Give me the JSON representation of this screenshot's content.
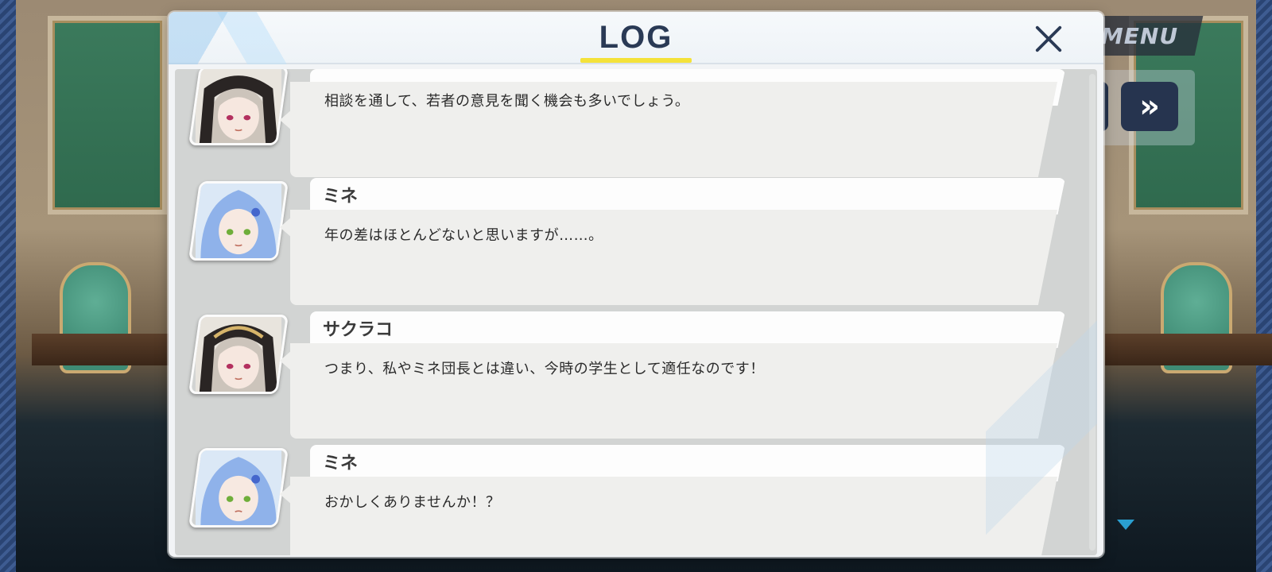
{
  "hud": {
    "menu_label": "MENU",
    "fast_forward_label": "»"
  },
  "log": {
    "title": "LOG",
    "close_label": "close",
    "entries": [
      {
        "speaker": "",
        "text": "相談を通して、若者の意見を聞く機会も多いでしょう。",
        "avatar": "sakurako"
      },
      {
        "speaker": "ミネ",
        "text": "年の差はほとんどないと思いますが……。",
        "avatar": "mine"
      },
      {
        "speaker": "サクラコ",
        "text": "つまり、私やミネ団長とは違い、今時の学生として適任なのです！",
        "avatar": "sakurako"
      },
      {
        "speaker": "ミネ",
        "text": "おかしくありませんか！？",
        "avatar": "mine"
      }
    ]
  },
  "colors": {
    "title_underline": "#f4e23a",
    "title_text": "#2a3a55",
    "menu_bg": "#282e3a",
    "ff_button_bg": "#26344f",
    "mine_hair": "#8fb2ea",
    "sakurako_hair": "#ccc4bb"
  }
}
